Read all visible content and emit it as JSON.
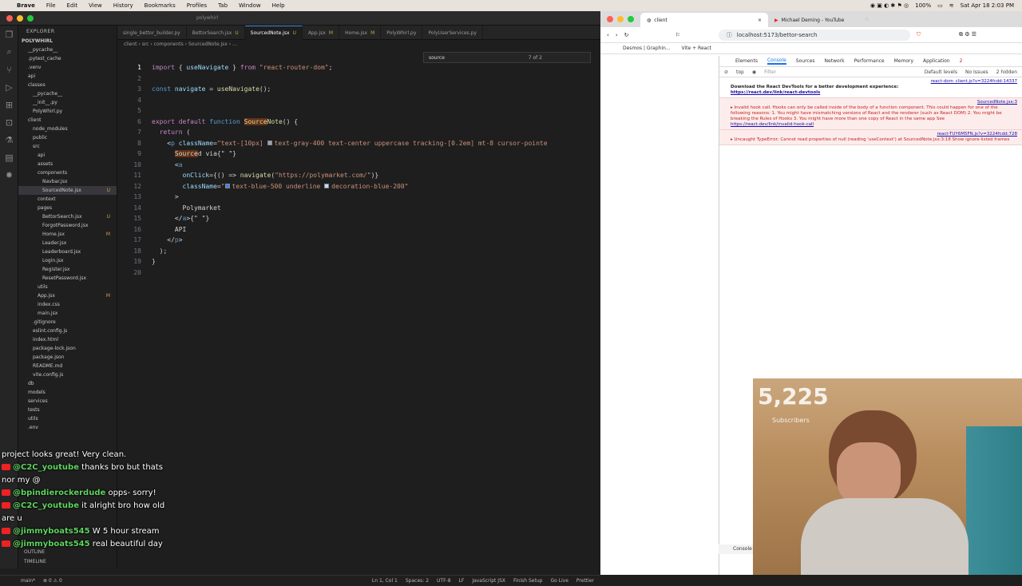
{
  "menubar": {
    "apple": "",
    "app": "Brave",
    "items": [
      "File",
      "Edit",
      "View",
      "History",
      "Bookmarks",
      "Profiles",
      "Tab",
      "Window",
      "Help"
    ],
    "battery": "100%",
    "datetime": "Sat Apr 18  2:03 PM"
  },
  "vscode": {
    "title": "polywhirl",
    "explorer_title": "EXPLORER",
    "project": "POLYWHIRL",
    "tree": [
      {
        "label": "__pycache__",
        "indent": 2,
        "badge": ""
      },
      {
        "label": ".pytest_cache",
        "indent": 2,
        "badge": ""
      },
      {
        "label": ".venv",
        "indent": 2,
        "badge": ""
      },
      {
        "label": "api",
        "indent": 2,
        "badge": ""
      },
      {
        "label": "classes",
        "indent": 2,
        "badge": ""
      },
      {
        "label": "__pycache__",
        "indent": 3,
        "badge": ""
      },
      {
        "label": "__init__.py",
        "indent": 3,
        "badge": ""
      },
      {
        "label": "PolyWhirl.py",
        "indent": 3,
        "badge": ""
      },
      {
        "label": "client",
        "indent": 2,
        "badge": ""
      },
      {
        "label": "node_modules",
        "indent": 3,
        "badge": ""
      },
      {
        "label": "public",
        "indent": 3,
        "badge": ""
      },
      {
        "label": "src",
        "indent": 3,
        "badge": ""
      },
      {
        "label": "api",
        "indent": 4,
        "badge": ""
      },
      {
        "label": "assets",
        "indent": 4,
        "badge": ""
      },
      {
        "label": "components",
        "indent": 4,
        "badge": ""
      },
      {
        "label": "Navbar.jsx",
        "indent": 5,
        "badge": ""
      },
      {
        "label": "SourcedNote.jsx",
        "indent": 5,
        "badge": "U",
        "sel": true
      },
      {
        "label": "context",
        "indent": 4,
        "badge": ""
      },
      {
        "label": "pages",
        "indent": 4,
        "badge": ""
      },
      {
        "label": "BettorSearch.jsx",
        "indent": 5,
        "badge": "U"
      },
      {
        "label": "ForgotPassword.jsx",
        "indent": 5,
        "badge": ""
      },
      {
        "label": "Home.jsx",
        "indent": 5,
        "badge": "M"
      },
      {
        "label": "Leader.jsx",
        "indent": 5,
        "badge": ""
      },
      {
        "label": "Leaderboard.jsx",
        "indent": 5,
        "badge": ""
      },
      {
        "label": "Login.jsx",
        "indent": 5,
        "badge": ""
      },
      {
        "label": "Register.jsx",
        "indent": 5,
        "badge": ""
      },
      {
        "label": "ResetPassword.jsx",
        "indent": 5,
        "badge": ""
      },
      {
        "label": "utils",
        "indent": 4,
        "badge": ""
      },
      {
        "label": "App.jsx",
        "indent": 4,
        "badge": "M"
      },
      {
        "label": "index.css",
        "indent": 4,
        "badge": ""
      },
      {
        "label": "main.jsx",
        "indent": 4,
        "badge": ""
      },
      {
        "label": ".gitignore",
        "indent": 3,
        "badge": ""
      },
      {
        "label": "eslint.config.js",
        "indent": 3,
        "badge": ""
      },
      {
        "label": "index.html",
        "indent": 3,
        "badge": ""
      },
      {
        "label": "package-lock.json",
        "indent": 3,
        "badge": ""
      },
      {
        "label": "package.json",
        "indent": 3,
        "badge": ""
      },
      {
        "label": "README.md",
        "indent": 3,
        "badge": ""
      },
      {
        "label": "vite.config.js",
        "indent": 3,
        "badge": ""
      },
      {
        "label": "db",
        "indent": 2,
        "badge": ""
      },
      {
        "label": "models",
        "indent": 2,
        "badge": ""
      },
      {
        "label": "services",
        "indent": 2,
        "badge": ""
      },
      {
        "label": "tests",
        "indent": 2,
        "badge": ""
      },
      {
        "label": "utils",
        "indent": 2,
        "badge": ""
      },
      {
        "label": ".env",
        "indent": 2,
        "badge": ""
      }
    ],
    "outline": "OUTLINE",
    "timeline": "TIMELINE",
    "tabs": [
      {
        "label": "single_bettor_builder.py",
        "mod": ""
      },
      {
        "label": "BettorSearch.jsx",
        "mod": "U"
      },
      {
        "label": "SourcedNote.jsx",
        "mod": "U",
        "active": true
      },
      {
        "label": "App.jsx",
        "mod": "M"
      },
      {
        "label": "Home.jsx",
        "mod": "M"
      },
      {
        "label": "PolyWhirl.py",
        "mod": ""
      },
      {
        "label": "PolyUserServices.py",
        "mod": ""
      }
    ],
    "breadcrumb": "client › src › components › SourcedNote.jsx › ...",
    "find": {
      "value": "source",
      "count": "7 of 2"
    },
    "status": {
      "branch": "main*",
      "problems": "⊗ 0 ⚠ 0",
      "position": "Ln 1, Col 1",
      "spaces": "Spaces: 2",
      "encoding": "UTF-8",
      "eol": "LF",
      "lang": "JavaScript JSX",
      "finish": "Finish Setup",
      "golive": "Go Live",
      "prettier": "Prettier"
    }
  },
  "code": [
    {
      "n": "1",
      "html": "<span class='kw'>import</span> <span class='pl'>{ </span><span class='vr'>useNavigate</span><span class='pl'> } </span><span class='kw'>from</span> <span class='st'>\"react-router-dom\"</span><span class='pl'>;</span>"
    },
    {
      "n": "2",
      "html": ""
    },
    {
      "n": "3",
      "html": "<span class='tg'>const</span> <span class='vr'>navigate</span> <span class='pl'>= </span><span class='fn'>useNavigate</span><span class='pl'>();</span>"
    },
    {
      "n": "4",
      "html": ""
    },
    {
      "n": "5",
      "html": ""
    },
    {
      "n": "6",
      "html": "<span class='kw'>export default</span> <span class='tg'>function</span> <span class='fn hl'>Source</span><span class='fn'>Note</span><span class='pl'>() {</span>"
    },
    {
      "n": "7",
      "html": "  <span class='kw'>return</span> <span class='pl'>(</span>"
    },
    {
      "n": "8",
      "html": "    <span class='pl'>&lt;</span><span class='tg'>p</span> <span class='at'>className</span><span class='pl'>=</span><span class='st'>\"text-[10px] <span class='swatch' style='background:#9ca3af'></span>text-gray-400 text-center uppercase tracking-[0.2em] mt-8 cursor-pointe</span>"
    },
    {
      "n": "9",
      "html": "      <span class='pl hl'>Source</span><span class='pl'>d via{\" \"}</span>"
    },
    {
      "n": "10",
      "html": "      <span class='pl'>&lt;</span><span class='tg'>a</span>"
    },
    {
      "n": "11",
      "html": "        <span class='at'>onClick</span><span class='pl'>={() =&gt; </span><span class='fn'>navigate</span><span class='pl'>(</span><span class='st'>\"https://polymarket.com/\"</span><span class='pl'>)}</span>"
    },
    {
      "n": "12",
      "html": "        <span class='at'>className</span><span class='pl'>=</span><span class='st'>\"<span class='swatch' style='background:#3b82f6'></span>text-blue-500 underline <span class='swatch' style='background:#bfdbfe'></span>decoration-blue-200\"</span>"
    },
    {
      "n": "13",
      "html": "      <span class='pl'>&gt;</span>"
    },
    {
      "n": "14",
      "html": "        <span class='pl'>Polymarket</span>"
    },
    {
      "n": "15",
      "html": "      <span class='pl'>&lt;/</span><span class='tg'>a</span><span class='pl'>&gt;{\" \"}</span>"
    },
    {
      "n": "16",
      "html": "      <span class='pl'>API</span>"
    },
    {
      "n": "17",
      "html": "    <span class='pl'>&lt;/</span><span class='tg'>p</span><span class='pl'>&gt;</span>"
    },
    {
      "n": "18",
      "html": "  <span class='pl'>);</span>"
    },
    {
      "n": "19",
      "html": "<span class='pl'>}</span>"
    },
    {
      "n": "20",
      "html": ""
    }
  ],
  "chat": [
    {
      "user": "",
      "text": "project looks great! Very clean."
    },
    {
      "user": "@C2C_youtube",
      "text": "thanks bro but thats nor my @"
    },
    {
      "user": "@bpindierockerdude",
      "text": "opps- sorry!"
    },
    {
      "user": "@C2C_youtube",
      "text": "it alright bro how old are u"
    },
    {
      "user": "@jimmyboats545",
      "text": "W 5 hour stream"
    },
    {
      "user": "@jimmyboats545",
      "text": "real beautiful day"
    }
  ],
  "browser": {
    "tab1": "client",
    "tab2": "Michael Deming - YouTube",
    "url": "localhost:5173/bettor-search",
    "bookmarks": [
      "Desmos | Graphin...",
      "Vite + React"
    ],
    "devtools_tabs": [
      "Elements",
      "Console",
      "Sources",
      "Network",
      "Performance",
      "Memory",
      "Application"
    ],
    "devtools_errors": "2",
    "filter": {
      "context": "top",
      "placeholder": "Filter",
      "levels": "Default levels",
      "issues": "No Issues",
      "hidden": "2 hidden"
    },
    "console": [
      {
        "type": "info",
        "text": "Download the React DevTools for a better development experience: ",
        "link": "https://react.dev/link/react-devtools",
        "src": "react-dom_client.js?v=3224fcdd:14337"
      },
      {
        "type": "err",
        "text": "▸ Invalid hook call. Hooks can only be called inside of the body of a function component. This could happen for one of the following reasons: 1. You might have mismatching versions of React and the renderer (such as React DOM) 2. You might be breaking the Rules of Hooks 3. You might have more than one copy of React in the same app See ",
        "link": "https://react.dev/link/invalid-hook-call",
        "src": "SourcedNote.jsx:3"
      },
      {
        "type": "err",
        "text": "▸ Uncaught TypeError: Cannot read properties of null (reading 'useContext') at SourcedNote.jsx:3:18  Show ignore-listed frames",
        "link": "",
        "src": "react-TUY6M5FN.js?v=3224fcdd:728"
      }
    ],
    "drawer": "Console"
  },
  "webcam": {
    "subs": "5,225",
    "subs_label": "Subscribers"
  }
}
